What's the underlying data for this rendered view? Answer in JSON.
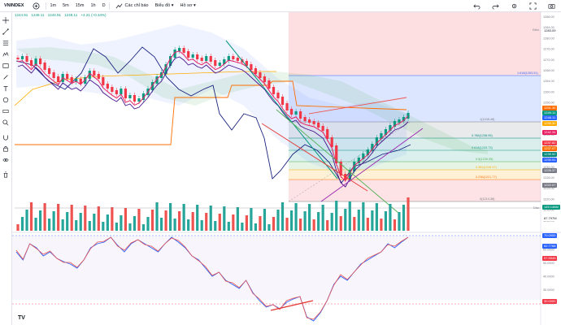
{
  "toolbar": {
    "symbol": "VNINDEX",
    "intervals": [
      "1m",
      "5m",
      "15m",
      "1h",
      "D"
    ],
    "indicators_label": "Các chỉ báo",
    "chart_type_label": "Biểu đồ",
    "layout_label": "Hồ sơ"
  },
  "ohlc": {
    "o": "1244.91",
    "h": "1249.11",
    "l": "1244.91",
    "c": "1249.11",
    "change": "+4.21 (+0.34%)"
  },
  "price_axis": {
    "ticks": [
      "1288.00",
      "1284.00",
      "1280.00",
      "1276.00",
      "1272.00",
      "1268.00",
      "1264.00",
      "1260.00",
      "1256.00",
      "1252.00",
      "1248.00",
      "1244.00",
      "1240.00",
      "1236.00",
      "1232.00",
      "1228.00",
      "1224.00",
      "1220.00",
      "1216.00",
      "1212.00"
    ],
    "labels": [
      {
        "text": "1283.09",
        "color": "#787b86"
      },
      {
        "text": "1251.30",
        "color": "#ff6d00"
      },
      {
        "text": "1249.11",
        "color": "#089981"
      },
      {
        "text": "1248.11",
        "color": "#2962ff"
      },
      {
        "text": "1246.30",
        "color": "#ffab00"
      },
      {
        "text": "1242.34",
        "color": "#e91e63"
      },
      {
        "text": "1237.82",
        "color": "#f23645"
      },
      {
        "text": "1237.07",
        "color": "#ff6d00"
      },
      {
        "text": "1235.52",
        "color": "#00897b"
      },
      {
        "text": "1230.91",
        "color": "#2962ff"
      },
      {
        "text": "1226.37",
        "color": "#787b86"
      },
      {
        "text": "1222.07",
        "color": "#787b86"
      }
    ],
    "top_tag": "Điều",
    "bottom_tag": "Dâu"
  },
  "fib_labels": [
    "1.618(1263.51)",
    "1(1245.48)",
    "0.786(1238.95)",
    "0.618(1233.73)",
    "0.5(1230.05)",
    "0.382(1226.37)",
    "0.236(1221.77)",
    "0(1214.38)"
  ],
  "volume_axis": {
    "labels": [
      "145.146M",
      "87.797M"
    ]
  },
  "rsi_axis": {
    "ticks": [
      "70.0000",
      "60.0000",
      "50.0000",
      "40.0000",
      "30.0000",
      "20.0000"
    ],
    "labels": [
      {
        "text": "70.0000",
        "color": "#2962ff"
      },
      {
        "text": "62.7768",
        "color": "#2962ff"
      },
      {
        "text": "57.5545",
        "color": "#f23645"
      },
      {
        "text": "30.0000",
        "color": "#f23645"
      }
    ]
  },
  "brand": "TV",
  "colors": {
    "up": "#089981",
    "down": "#f23645",
    "fib_top": "#2962ff",
    "fib_red": "#f23645"
  }
}
